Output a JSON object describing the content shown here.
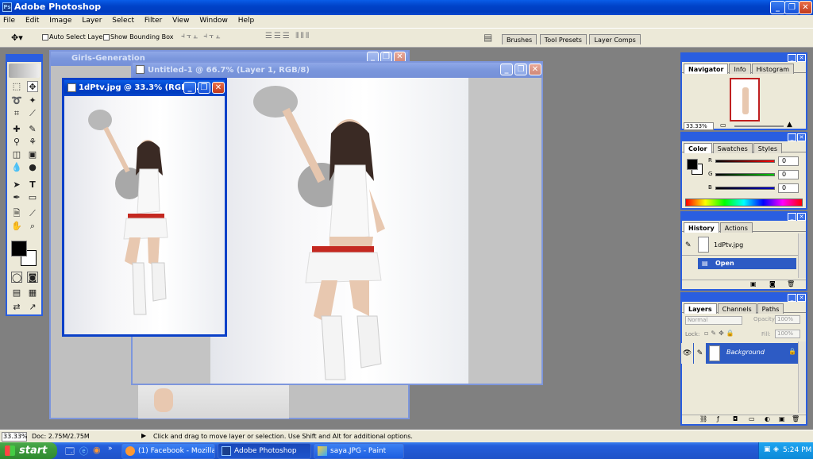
{
  "app": {
    "title": "Adobe Photoshop"
  },
  "menu": [
    "File",
    "Edit",
    "Image",
    "Layer",
    "Select",
    "Filter",
    "View",
    "Window",
    "Help"
  ],
  "options": {
    "auto_select": "Auto Select Layer",
    "show_bounding": "Show Bounding Box"
  },
  "palette_well": [
    "Brushes",
    "Tool Presets",
    "Layer Comps"
  ],
  "documents": {
    "back": {
      "title": "Girls-Generation"
    },
    "untitled": {
      "title": "Untitled-1 @ 66.7% (Layer 1, RGB/8)"
    },
    "active": {
      "title": "1dPtv.jpg @ 33.3% (RGB/..."
    }
  },
  "navigator": {
    "tabs": [
      "Navigator",
      "Info",
      "Histogram"
    ],
    "zoom": "33.33%"
  },
  "color": {
    "tabs": [
      "Color",
      "Swatches",
      "Styles"
    ],
    "r_label": "R",
    "g_label": "G",
    "b_label": "B",
    "r": "0",
    "g": "0",
    "b": "0"
  },
  "history": {
    "tabs": [
      "History",
      "Actions"
    ],
    "snapshot": "1dPtv.jpg",
    "step": "Open"
  },
  "layers": {
    "tabs": [
      "Layers",
      "Channels",
      "Paths"
    ],
    "mode": "Normal",
    "opacity_label": "Opacity:",
    "opacity": "100%",
    "lock_label": "Lock:",
    "fill_label": "Fill:",
    "fill": "100%",
    "layer_name": "Background"
  },
  "status": {
    "zoom": "33.33%",
    "doc": "Doc: 2.75M/2.75M",
    "hint": "Click and drag to move layer or selection.  Use Shift and Alt for additional options."
  },
  "taskbar": {
    "start": "start",
    "items": [
      "(1) Facebook - Mozilla...",
      "Adobe Photoshop",
      "saya.JPG - Paint"
    ],
    "clock": "5:24 PM"
  },
  "colors": {
    "xp_blue": "#0042c8",
    "panel_bg": "#ece9d8",
    "taskbar": "#245edb",
    "start_green": "#3c9a3c"
  }
}
